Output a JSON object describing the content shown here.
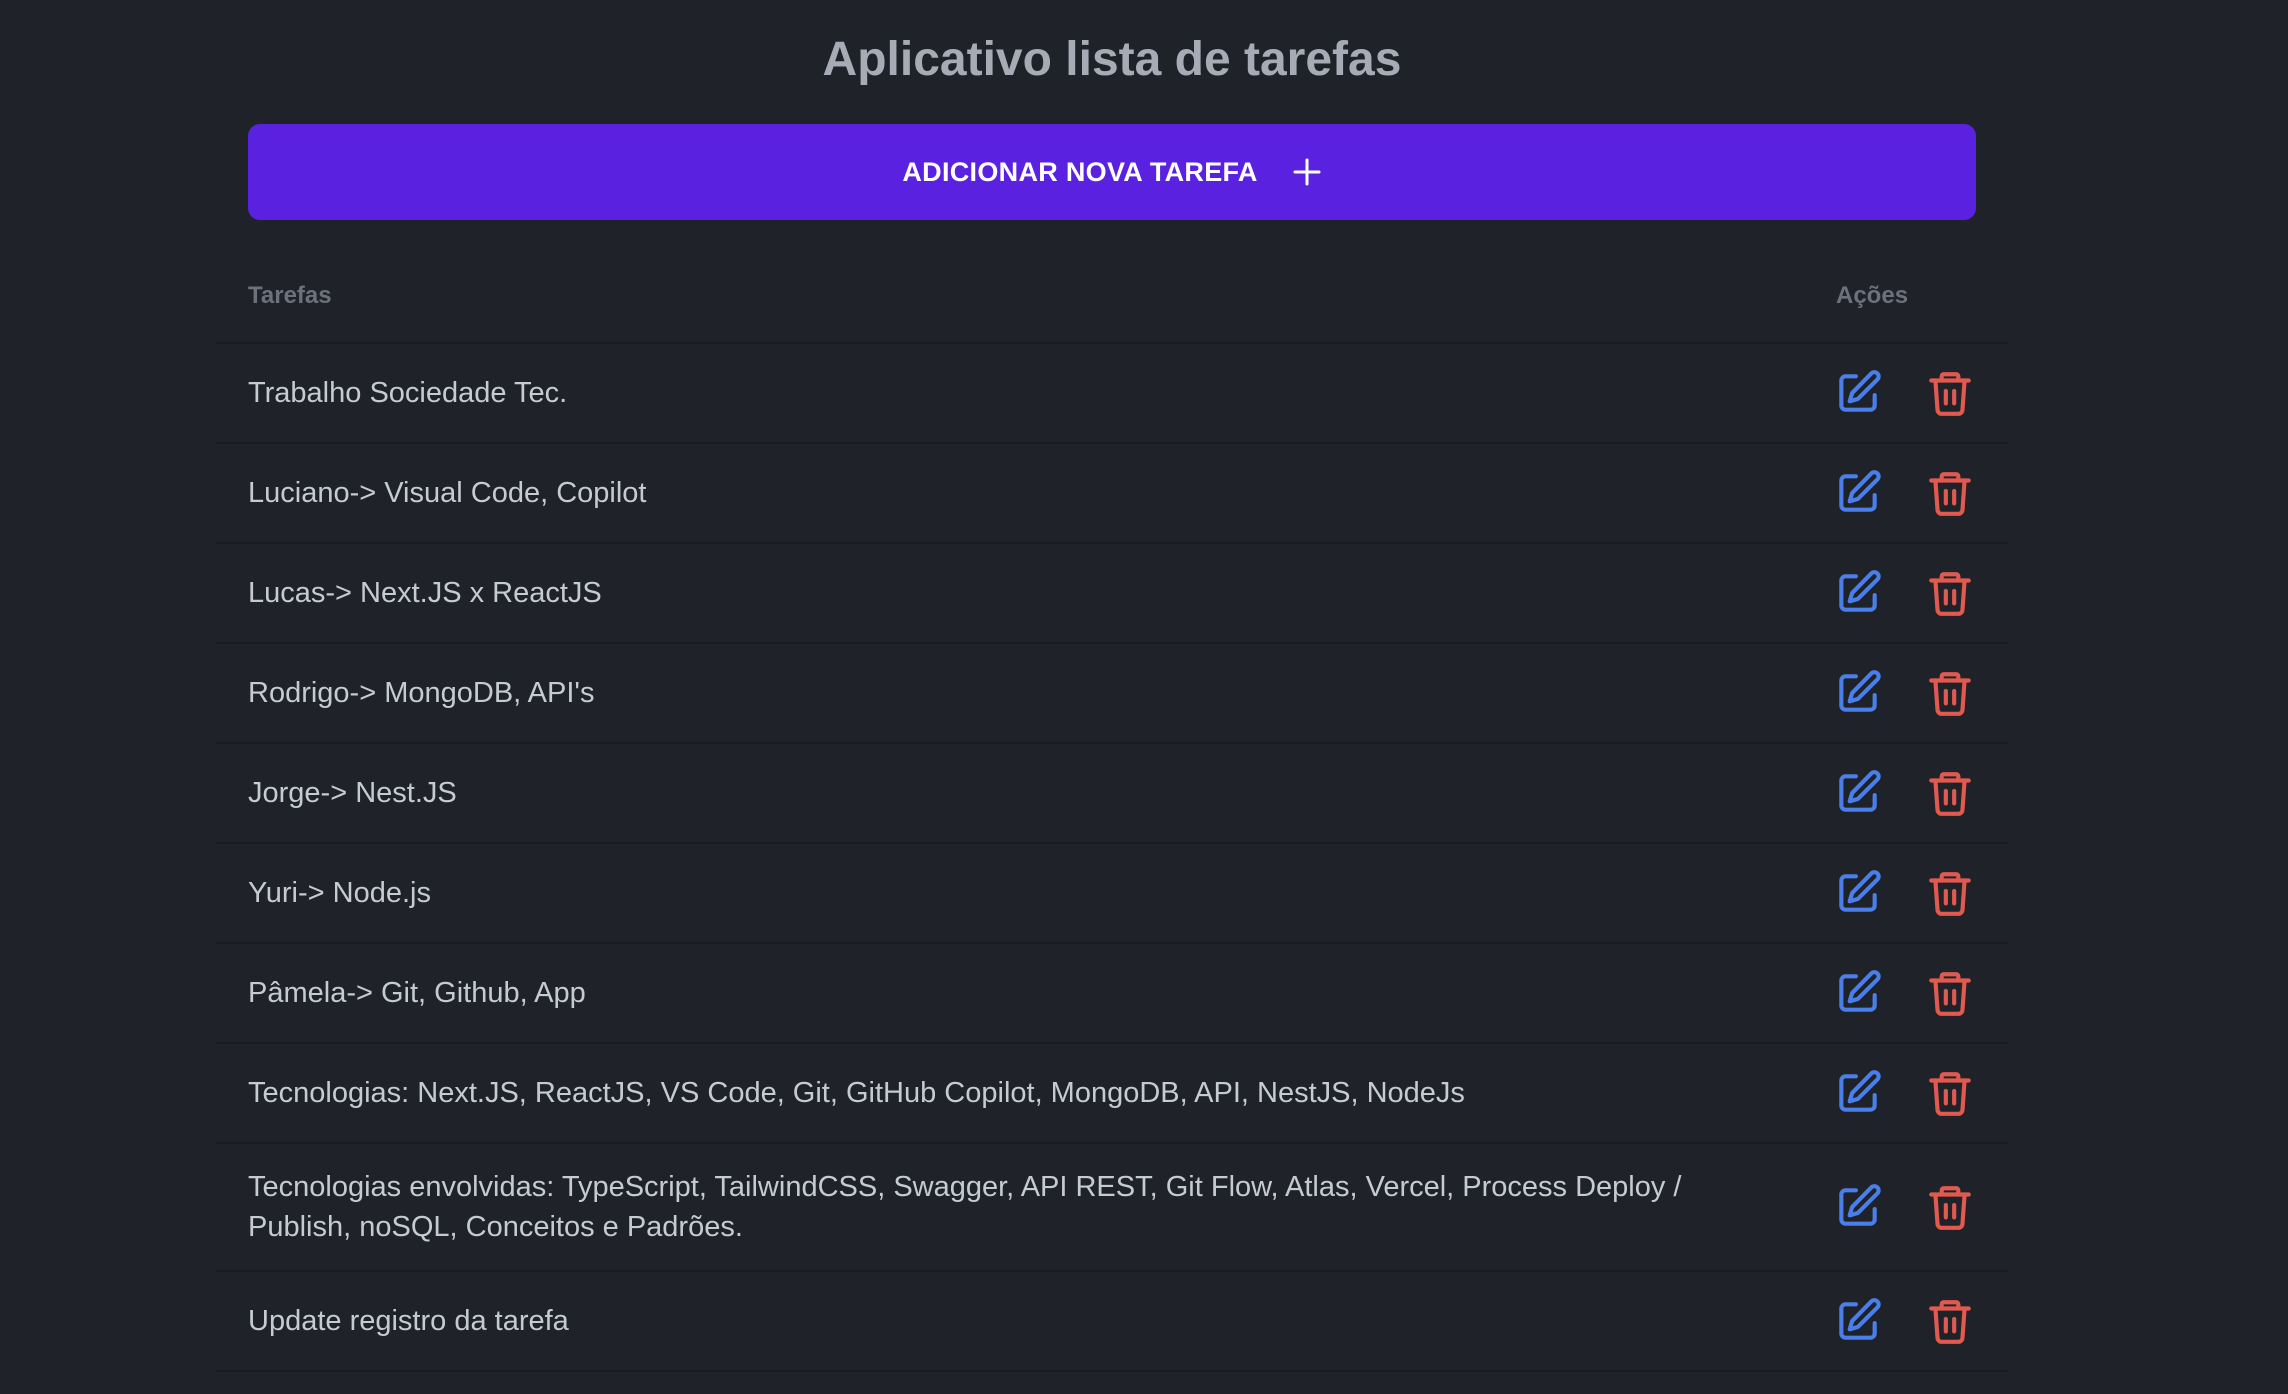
{
  "header": {
    "title": "Aplicativo lista de tarefas"
  },
  "add_button": {
    "label": "ADICIONAR NOVA TAREFA",
    "icon": "plus-icon"
  },
  "table": {
    "columns": [
      "Tarefas",
      "Ações"
    ],
    "rows": [
      "Trabalho Sociedade Tec.",
      "Luciano-> Visual Code, Copilot",
      "Lucas-> Next.JS x ReactJS",
      "Rodrigo-> MongoDB, API's",
      "Jorge-> Nest.JS",
      "Yuri-> Node.js",
      "Pâmela-> Git, Github, App",
      "Tecnologias: Next.JS, ReactJS, VS Code, Git, GitHub Copilot, MongoDB, API, NestJS, NodeJs",
      "Tecnologias envolvidas: TypeScript, TailwindCSS, Swagger, API REST, Git Flow, Atlas, Vercel, Process Deploy / Publish, noSQL, Conceitos e Padrões.",
      "Update registro da tarefa"
    ],
    "actions": {
      "edit_icon": "edit-icon",
      "delete_icon": "trash-icon"
    }
  },
  "colors": {
    "background": "#1f2229",
    "accent": "#5b21e0",
    "edit": "#4a7ee8",
    "delete": "#e05a50"
  }
}
